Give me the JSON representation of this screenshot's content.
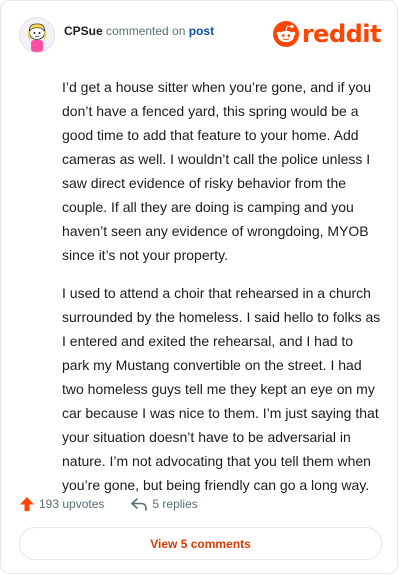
{
  "header": {
    "username": "CPSue",
    "action_text": " commented on ",
    "target_link": "post",
    "logo_word": "reddit"
  },
  "comment": {
    "paragraphs": [
      "I’d get a house sitter when you’re gone, and if you don’t have a fenced yard, this spring would be a good time to add that feature to your home. Add cameras as well. I wouldn’t call the police unless I saw direct evidence of risky behavior from the couple. If all they are doing is camping and you haven’t seen any evidence of wrongdoing, MYOB since it’s not your property.",
      "I used to attend a choir that rehearsed in a church surrounded by the homeless. I said hello to folks as I entered and exited the rehearsal, and I had to park my Mustang convertible on the street. I had two homeless guys tell me they kept an eye on my car because I was nice to them. I’m just saying that your situation doesn’t have to be adversarial in nature. I’m not advocating that you tell them when you’re gone, but being friendly can go a long way."
    ]
  },
  "actions": {
    "upvotes_label": "193 upvotes",
    "replies_label": "5 replies",
    "view_comments_label": "View 5 comments"
  },
  "colors": {
    "brand": "#ff4500",
    "link": "#0a4fa8",
    "button_text": "#d93a00",
    "muted": "#576f76"
  },
  "icons": {
    "avatar": "snoo-avatar",
    "logo": "reddit-snoo-icon",
    "upvote": "upvote-arrow-icon",
    "reply": "reply-arrow-icon"
  }
}
